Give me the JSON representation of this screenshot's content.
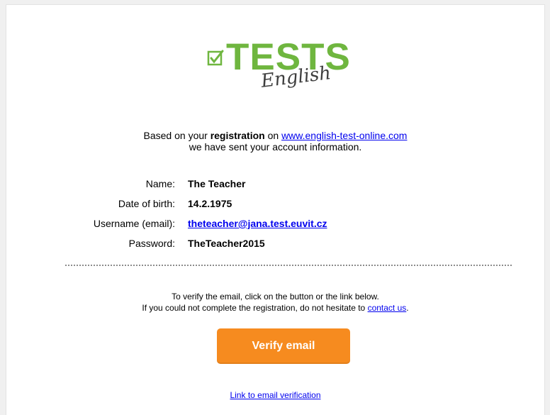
{
  "logo": {
    "word": "TESTS",
    "subword": "English",
    "icon": "checkbox-check-icon",
    "color": "#6fb63f"
  },
  "intro": {
    "line1_before": "Based on your ",
    "line1_bold": "registration",
    "line1_mid": " on ",
    "link_text": "www.english-test-online.com",
    "line2": "we have sent your account information."
  },
  "account": [
    {
      "label": "Name:",
      "value": "The Teacher"
    },
    {
      "label": "Date of birth:",
      "value": "14.2.1975"
    },
    {
      "label": "Username (email):",
      "value": "theteacher@jana.test.euvit.cz"
    },
    {
      "label": "Password:",
      "value": "TheTeacher2015"
    }
  ],
  "verify": {
    "line1": "To verify the email, click on the button or the link below.",
    "line2_before": "If you could not complete the registration, do not hesitate to ",
    "contact_link": "contact us",
    "line2_after": ".",
    "button_label": "Verify email",
    "link_label": "Link to email verification"
  },
  "colors": {
    "button": "#f68b1f",
    "link": "#0000ee"
  }
}
